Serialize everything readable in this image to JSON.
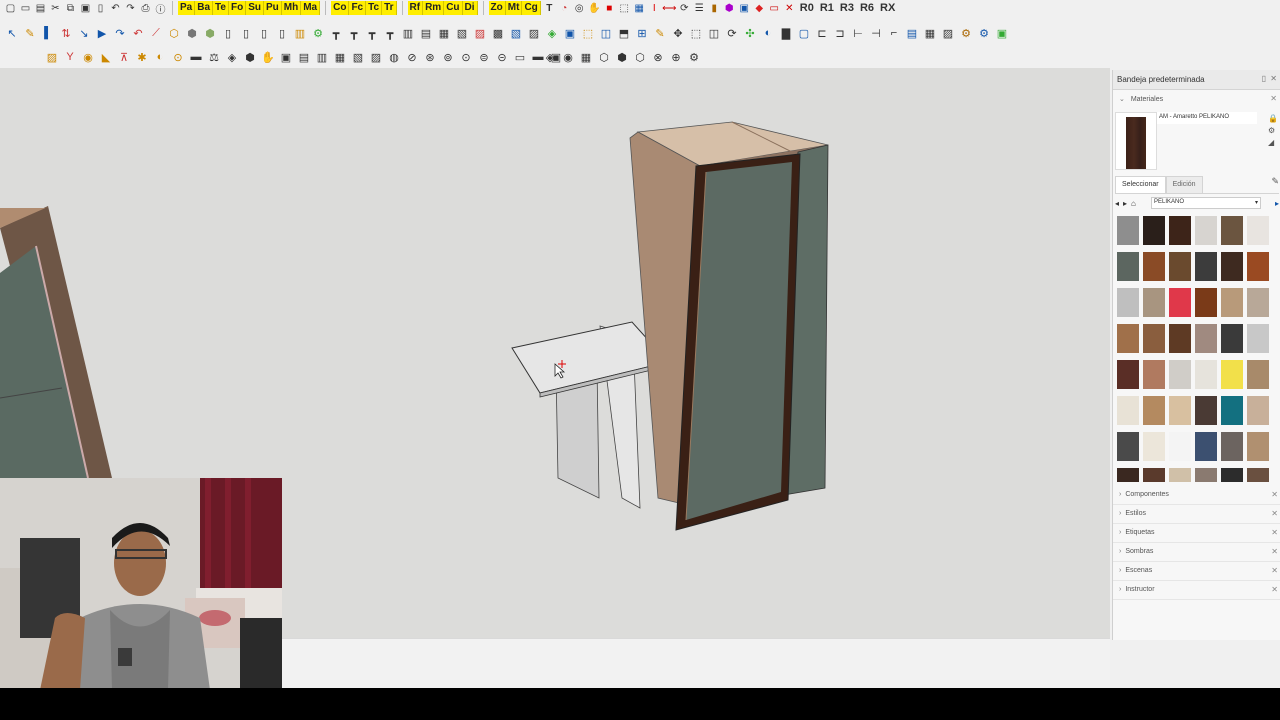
{
  "toolbar1": {
    "yellow_groups": [
      [
        "Pa",
        "Ba",
        "Te",
        "Fo",
        "Su",
        "Pu",
        "Mh",
        "Ma"
      ],
      [
        "Co",
        "Fc",
        "Tc",
        "Tr"
      ],
      [
        "Rf",
        "Rm",
        "Cu",
        "Di"
      ],
      [
        "Zo",
        "Mt",
        "Cg"
      ]
    ],
    "right_labels": [
      "R0",
      "R1",
      "R3",
      "R6",
      "RX"
    ]
  },
  "tray": {
    "title": "Bandeja predeterminada",
    "materials_section": "Materiales",
    "material_name": "AM - Amaretto PELIKANO",
    "tabs": [
      "Seleccionar",
      "Edición"
    ],
    "library": "PELIKANO",
    "swatch_colors": [
      "#8e8e8e",
      "#2a1f1a",
      "#3d2419",
      "#d7d4d0",
      "#6b5540",
      "#e8e4e0",
      "#5c6660",
      "#8a4b26",
      "#6a4a2e",
      "#3c3c3c",
      "#3e2a20",
      "#9a4a22",
      "#bfbfbf",
      "#a89580",
      "#e0384a",
      "#7a3a18",
      "#b89a7a",
      "#b8a898",
      "#a0704a",
      "#8a5e3e",
      "#5e3a24",
      "#a08a80",
      "#3a3a3a",
      "#c8c8c8",
      "#5a2e26",
      "#b07a60",
      "#d0cdc8",
      "#e6e3dc",
      "#f2e04a",
      "#a88a6a",
      "#e8e2d6",
      "#b48a60",
      "#d8c0a0",
      "#4a3a34",
      "#137080",
      "#c8b09a",
      "#4a4a4a",
      "#ece6da",
      "#f4f4f4",
      "#3c5070",
      "#6c6460",
      "#b09070",
      "#3a2820",
      "#5a3a2c",
      "#d0c0a8",
      "#8a7a70",
      "#2c2c2c",
      "#6a5040"
    ],
    "sections": [
      "Componentes",
      "Estilos",
      "Etiquetas",
      "Sombras",
      "Escenas",
      "Instructor"
    ]
  },
  "colors": {
    "viewport_bg": "#dcdcda",
    "wood": "#ad8c73",
    "green_panel": "#5c6a63",
    "dark_frame": "#3a2015"
  }
}
